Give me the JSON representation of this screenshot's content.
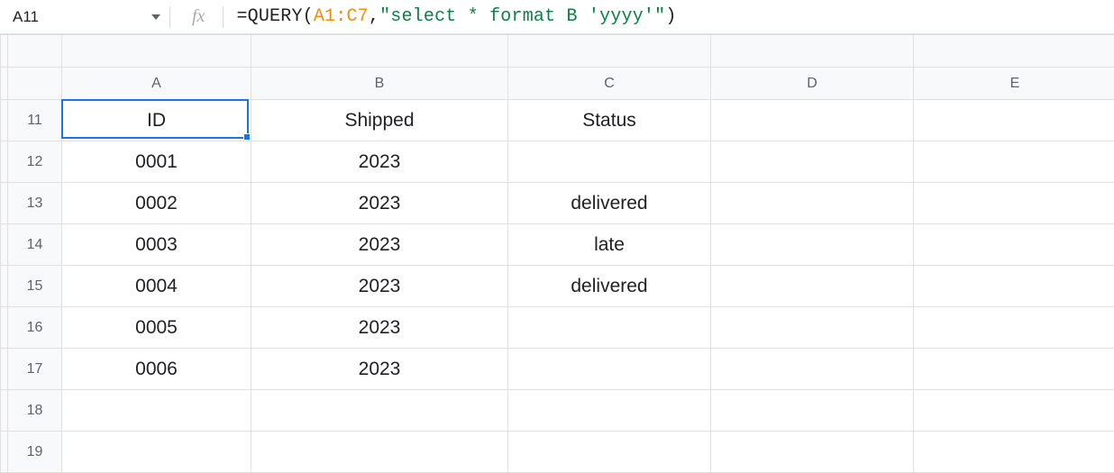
{
  "nameBox": {
    "value": "A11"
  },
  "formulaBar": {
    "prefix": "=",
    "funcName": "QUERY",
    "open": "(",
    "range": "A1:C7",
    "comma": ",",
    "string": "\"select * format B 'yyyy'\"",
    "close": ")"
  },
  "columns": [
    "A",
    "B",
    "C",
    "D",
    "E"
  ],
  "rows": [
    {
      "num": "11",
      "cells": [
        "ID",
        "Shipped",
        "Status",
        "",
        ""
      ]
    },
    {
      "num": "12",
      "cells": [
        "0001",
        "2023",
        "",
        "",
        ""
      ]
    },
    {
      "num": "13",
      "cells": [
        "0002",
        "2023",
        "delivered",
        "",
        ""
      ]
    },
    {
      "num": "14",
      "cells": [
        "0003",
        "2023",
        "late",
        "",
        ""
      ]
    },
    {
      "num": "15",
      "cells": [
        "0004",
        "2023",
        "delivered",
        "",
        ""
      ]
    },
    {
      "num": "16",
      "cells": [
        "0005",
        "2023",
        "",
        "",
        ""
      ]
    },
    {
      "num": "17",
      "cells": [
        "0006",
        "2023",
        "",
        "",
        ""
      ]
    },
    {
      "num": "18",
      "cells": [
        "",
        "",
        "",
        "",
        ""
      ]
    },
    {
      "num": "19",
      "cells": [
        "",
        "",
        "",
        "",
        ""
      ]
    }
  ],
  "activeCell": {
    "row": 0,
    "col": 0
  }
}
